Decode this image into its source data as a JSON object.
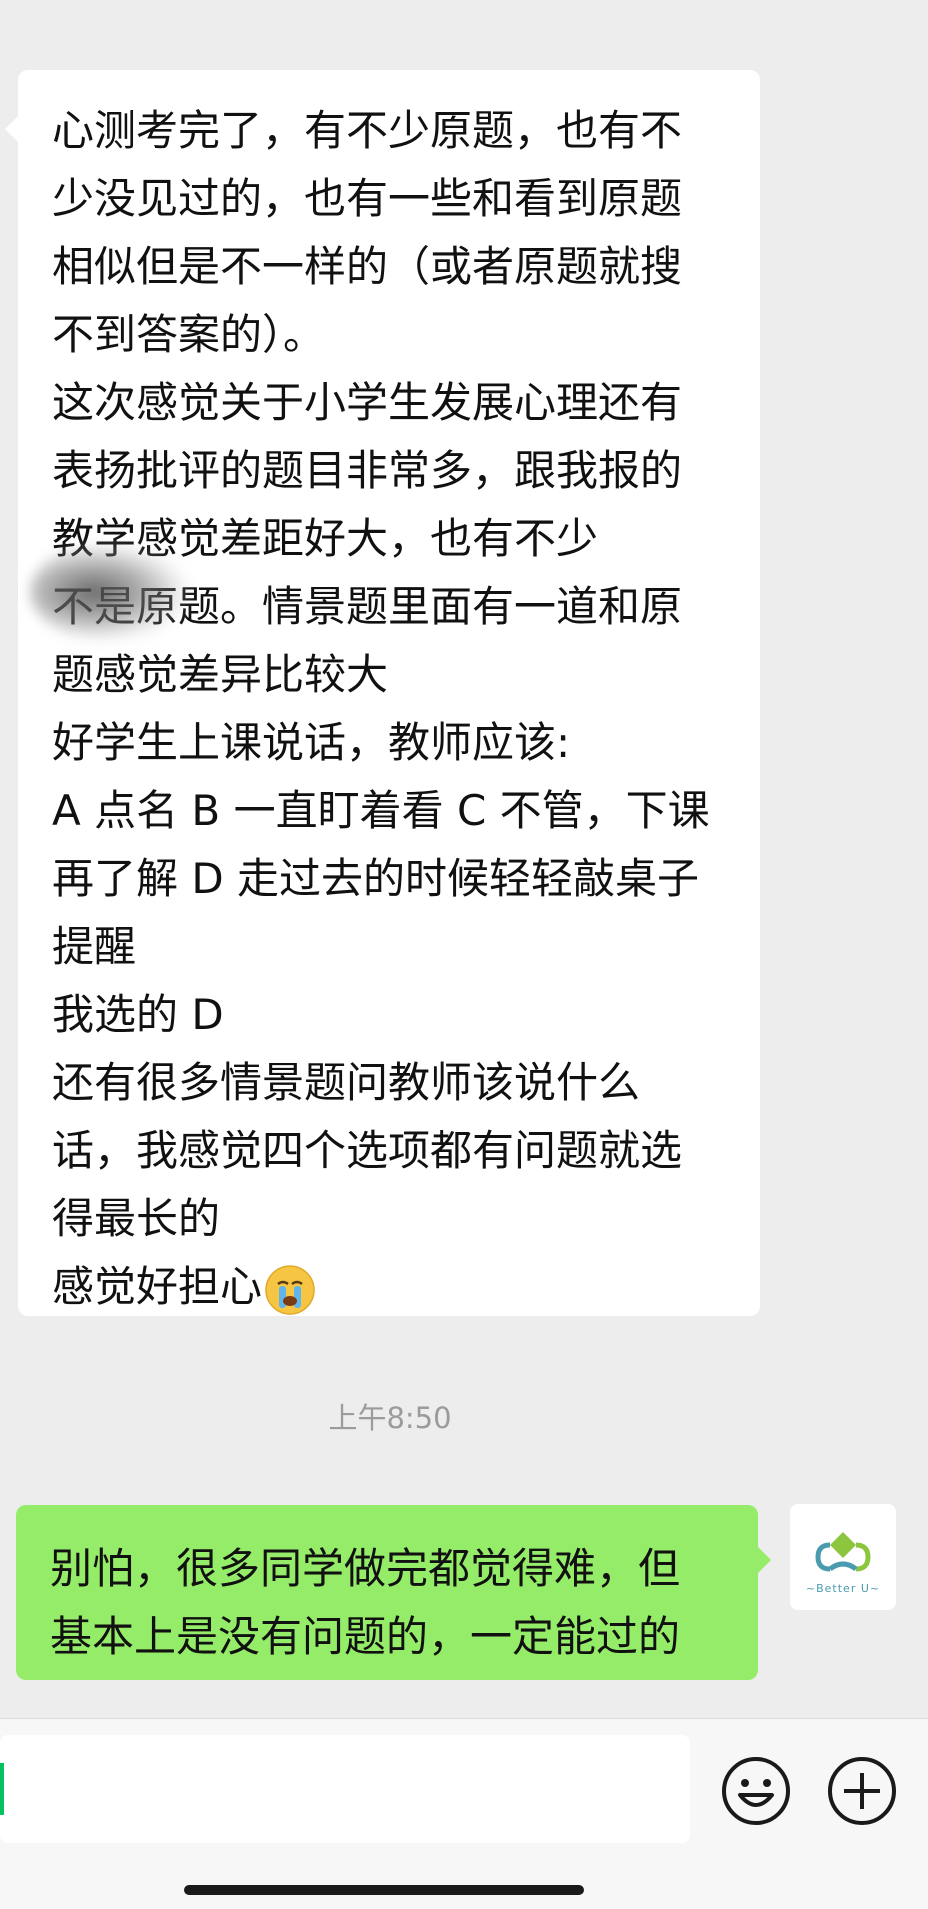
{
  "received_message": {
    "lines": [
      "心测考完了，有不少原题，也有不",
      "少没见过的，也有一些和看到原题",
      "相似但是不一样的（或者原题就搜",
      "不到答案的）。",
      "这次感觉关于小学生发展心理还有",
      "表扬批评的题目非常多，跟我报的",
      "教学感觉差距好大，也有不少",
      "不是原题。情景题里面有一道和原",
      "题感觉差异比较大",
      "好学生上课说话，教师应该:",
      "A 点名 B 一直盯着看 C 不管，下课",
      "再了解 D 走过去的时候轻轻敲桌子",
      "提醒",
      "我选的 D",
      "还有很多情景题问教师该说什么",
      "话，我感觉四个选项都有问题就选",
      "得最长的",
      "感觉好担心"
    ],
    "emoji": "crying-face-icon"
  },
  "timestamp": "上午8:50",
  "sent_message": {
    "lines": [
      "别怕，很多同学做完都觉得难，但",
      "基本上是没有问题的，一定能过的"
    ]
  },
  "avatar": {
    "text": "~Better U~"
  },
  "input_bar": {
    "text_value": "",
    "emoji_button": "smiley-face-icon",
    "add_button": "plus-circle-icon"
  },
  "colors": {
    "background": "#ededed",
    "incoming_bubble": "#ffffff",
    "outgoing_bubble": "#95ec69",
    "timestamp": "#9b9b9b",
    "cursor": "#07c160"
  }
}
